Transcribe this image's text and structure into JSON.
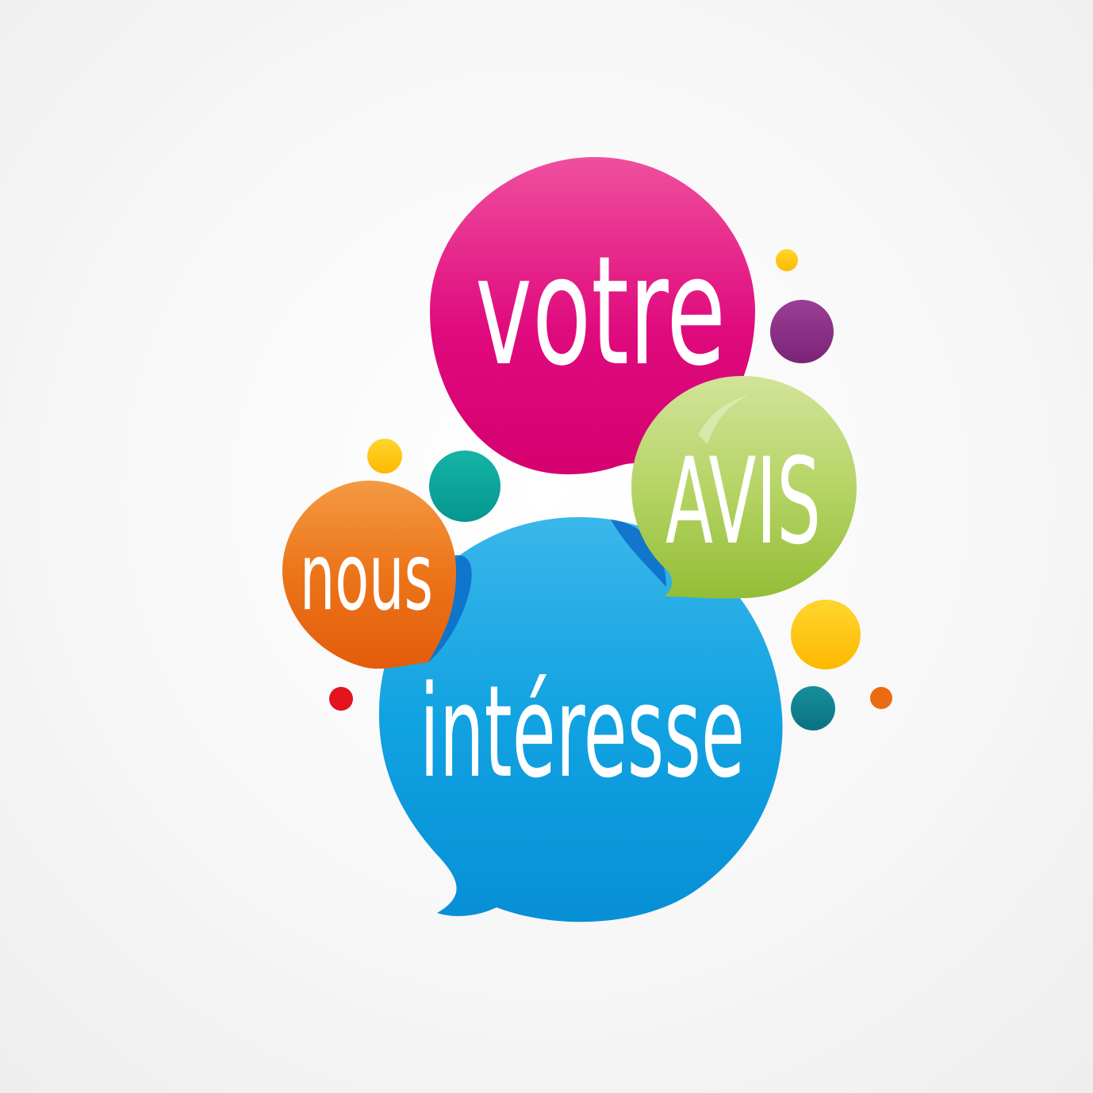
{
  "words": {
    "votre": "votre",
    "avis": "AVIS",
    "nous": "nous",
    "interesse": "intéresse"
  },
  "colors": {
    "magenta": "#e0047e",
    "magenta_light": "#ec4a9c",
    "green": "#a6c845",
    "green_light": "#cde08f",
    "orange": "#e9660e",
    "orange_light": "#f2913a",
    "blue": "#0c97dc",
    "blue_light": "#36b6ea",
    "yellow": "#ffc400",
    "purple": "#8a2e86",
    "teal": "#0aa59a",
    "dark_teal": "#0e7f8f",
    "red": "#e2141f",
    "small_orange": "#ea6b12"
  }
}
